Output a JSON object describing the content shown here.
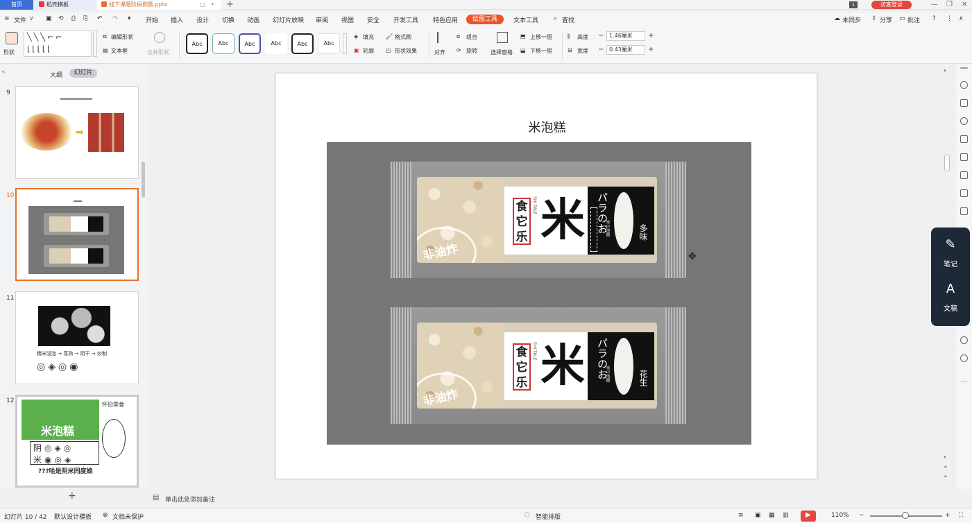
{
  "titlebar": {
    "home_tab": "首页",
    "template_tab": "稻壳模板",
    "doc_tab": "线下课题阶段例题.pptx",
    "login": "访客登录",
    "win_badge": "1"
  },
  "menu": {
    "file": "文件",
    "items": [
      "开始",
      "插入",
      "设计",
      "切换",
      "动画",
      "幻灯片放映",
      "审阅",
      "视图",
      "安全",
      "开发工具",
      "特色应用"
    ],
    "drawing_tools": "绘图工具",
    "text_tools": "文本工具",
    "search": "查找",
    "sync": "未同步",
    "share": "分享",
    "comment": "批注"
  },
  "ribbon": {
    "shape": "形状",
    "edit_shape": "编辑形状",
    "textbox": "文本框",
    "merge_shape": "合并形状",
    "style_samples": [
      "Abc",
      "Abc",
      "Abc",
      "Abc",
      "Abc",
      "Abc"
    ],
    "fill": "填充",
    "format_painter": "格式刷",
    "outline": "轮廓",
    "shape_effect": "形状效果",
    "align": "对齐",
    "group": "组合",
    "rotate": "旋转",
    "select_pane": "选择窗格",
    "bring_forward": "上移一层",
    "send_backward": "下移一层",
    "height_label": "高度",
    "height_value": "1.46厘米",
    "width_label": "宽度",
    "width_value": "0.43厘米"
  },
  "leftpanel": {
    "outline_tab": "大纲",
    "slides_tab": "幻灯片",
    "slide_numbers": [
      "9",
      "10",
      "11",
      "12"
    ],
    "thumb11_caption": "糯米浸泡 → 蒸熟 → 阴干 → 炒制",
    "thumb12_title": "米泡糕",
    "thumb12_side": "怀旧零食",
    "thumb12_bottom": "???哈是阴米同度娘"
  },
  "slide": {
    "title": "米泡糕",
    "pack1": {
      "stamp": "非油炸",
      "brand": "食它乐",
      "brand_en": "SHI TALE",
      "big_char": "米",
      "jp": "パラのお",
      "small": "米の泡圖",
      "flavor": "多味"
    },
    "pack2": {
      "stamp": "非油炸",
      "brand": "食它乐",
      "brand_en": "SHI TALE",
      "big_char": "米",
      "jp": "パラのお",
      "small": "米の泡圖",
      "flavor": "花生"
    }
  },
  "float_panel": {
    "notes": "笔记",
    "docs": "文稿"
  },
  "notes_placeholder": "单击此处添加备注",
  "status": {
    "slide_count": "幻灯片 10 / 42",
    "theme": "默认设计模板",
    "protect": "文档未保护",
    "smart": "智能排版",
    "zoom": "110%"
  },
  "colors": {
    "accent": "#e8562a",
    "home_tab": "#3b6fd6",
    "login": "#e2483d",
    "float_panel": "#1e2937"
  }
}
